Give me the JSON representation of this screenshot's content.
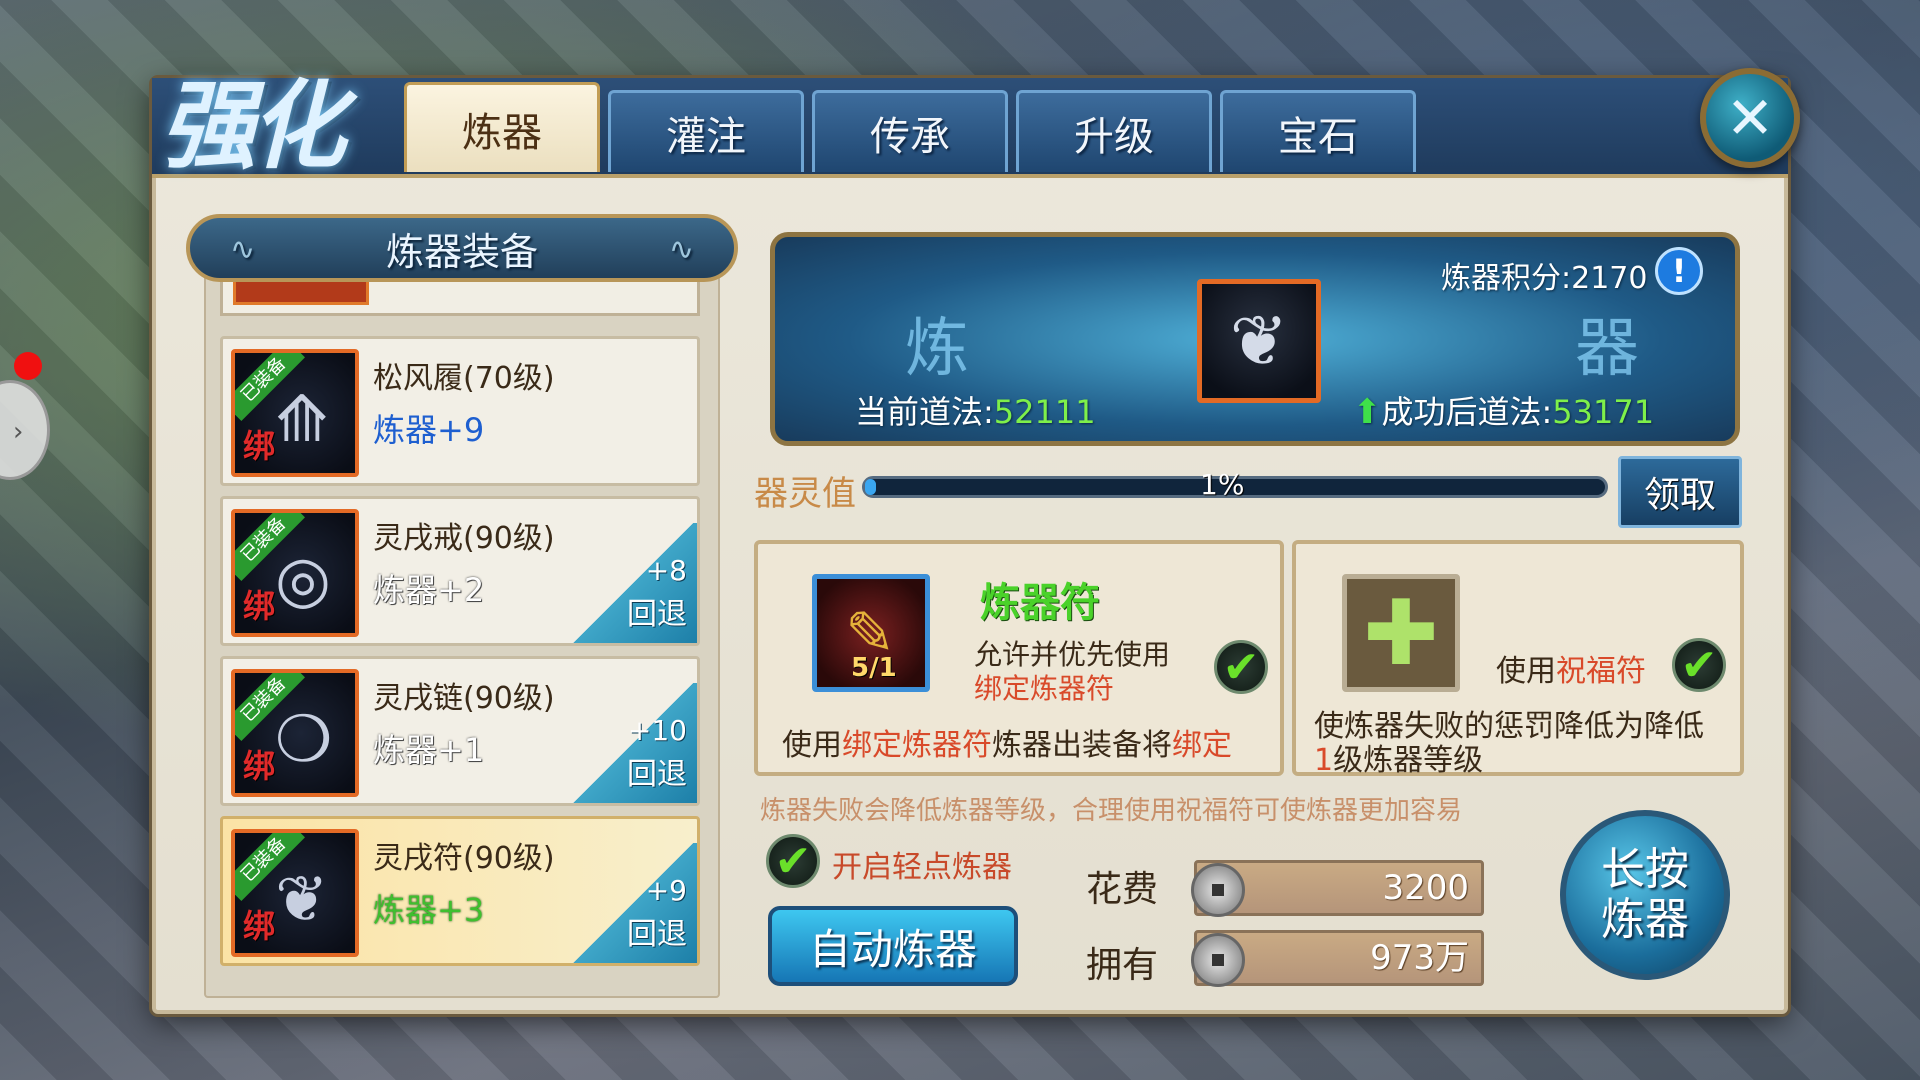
{
  "tabs": [
    {
      "label": "炼器",
      "active": true
    },
    {
      "label": "灌注",
      "active": false
    },
    {
      "label": "传承",
      "active": false
    },
    {
      "label": "升级",
      "active": false
    },
    {
      "label": "宝石",
      "active": false
    }
  ],
  "close_icon": "✕",
  "list": {
    "title": "炼器装备",
    "items": [
      {
        "name": "松风履(70级)",
        "refine": "炼器+9",
        "equipped_badge": "已装备",
        "bind_badge": "绑",
        "icon": "boots-icon"
      },
      {
        "name": "灵戌戒(90级)",
        "refine": "炼器+2",
        "equipped_badge": "已装备",
        "bind_badge": "绑",
        "rollback_value": "+8",
        "rollback_label": "回退",
        "icon": "ring-icon"
      },
      {
        "name": "灵戌链(90级)",
        "refine": "炼器+1",
        "equipped_badge": "已装备",
        "bind_badge": "绑",
        "rollback_value": "+10",
        "rollback_label": "回退",
        "icon": "necklace-icon"
      },
      {
        "name": "灵戌符(90级)",
        "refine": "炼器+3",
        "equipped_badge": "已装备",
        "bind_badge": "绑",
        "rollback_value": "+9",
        "rollback_label": "回退",
        "icon": "talisman-icon",
        "selected": true
      }
    ]
  },
  "banner": {
    "char_left": "炼",
    "char_right": "器",
    "score_label": "炼器积分:",
    "score_value": "2170",
    "info_icon": "!",
    "current_label": "当前道法:",
    "current_value": "52111",
    "after_label": "成功后道法:",
    "after_value": "53171"
  },
  "spirit": {
    "label": "器灵值",
    "percent_text": "1%",
    "percent": 1
  },
  "claim_label": "领取",
  "talisman": {
    "title": "炼器符",
    "count": "5/1",
    "desc_line1": "允许并优先使用",
    "desc_line2": "绑定炼器符",
    "foot_part1": "使用",
    "foot_part2": "绑定炼器符",
    "foot_part3": "炼器出装备将",
    "foot_part4": "绑定"
  },
  "blessing": {
    "label_part1": "使用",
    "label_part2": "祝福符",
    "foot_line1": "使炼器失败的惩罚降低为降低",
    "foot_num": "1",
    "foot_line2": "级炼器等级"
  },
  "tip": "炼器失败会降低炼器等级，合理使用祝福符可使炼器更加容易",
  "easy_refine_label": "开启轻点炼器",
  "auto_refine_label": "自动炼器",
  "cost_label": "花费",
  "cost_value": "3200",
  "own_label": "拥有",
  "own_value": "973万",
  "hold_refine_line1": "长按",
  "hold_refine_line2": "炼器",
  "logo_text": "强化"
}
